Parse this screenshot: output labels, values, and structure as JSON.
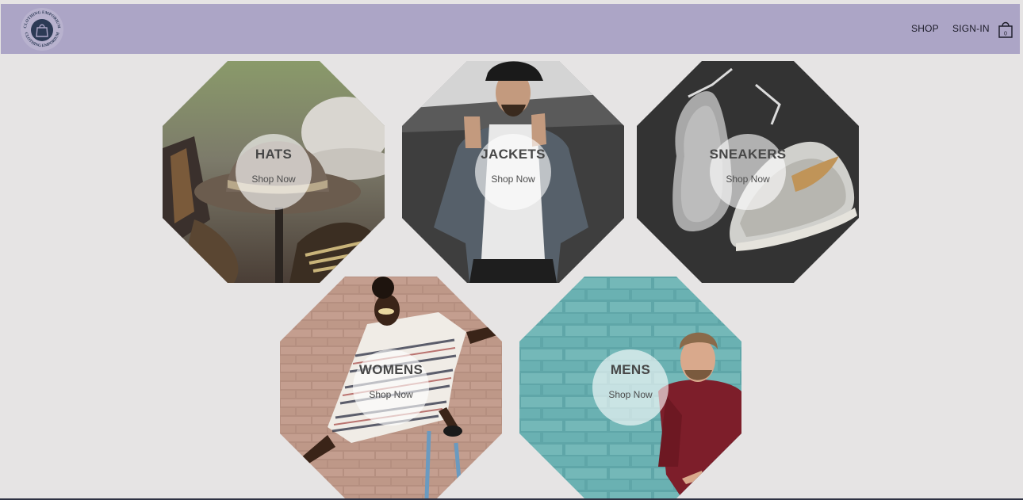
{
  "header": {
    "logo_text": "CLOTHING EMPORIUM",
    "logo_icon": "shopping-bag-icon",
    "nav": {
      "shop_label": "SHOP",
      "signin_label": "SIGN-IN"
    },
    "cart_icon": "shopping-bag-icon",
    "cart_count": "0",
    "background_color": "#aca5c6"
  },
  "categories": [
    {
      "title": "HATS",
      "cta": "Shop Now"
    },
    {
      "title": "JACKETS",
      "cta": "Shop Now"
    },
    {
      "title": "SNEAKERS",
      "cta": "Shop Now"
    },
    {
      "title": "WOMENS",
      "cta": "Shop Now"
    },
    {
      "title": "MENS",
      "cta": "Shop Now"
    }
  ],
  "page_background": "#e6e4e4"
}
